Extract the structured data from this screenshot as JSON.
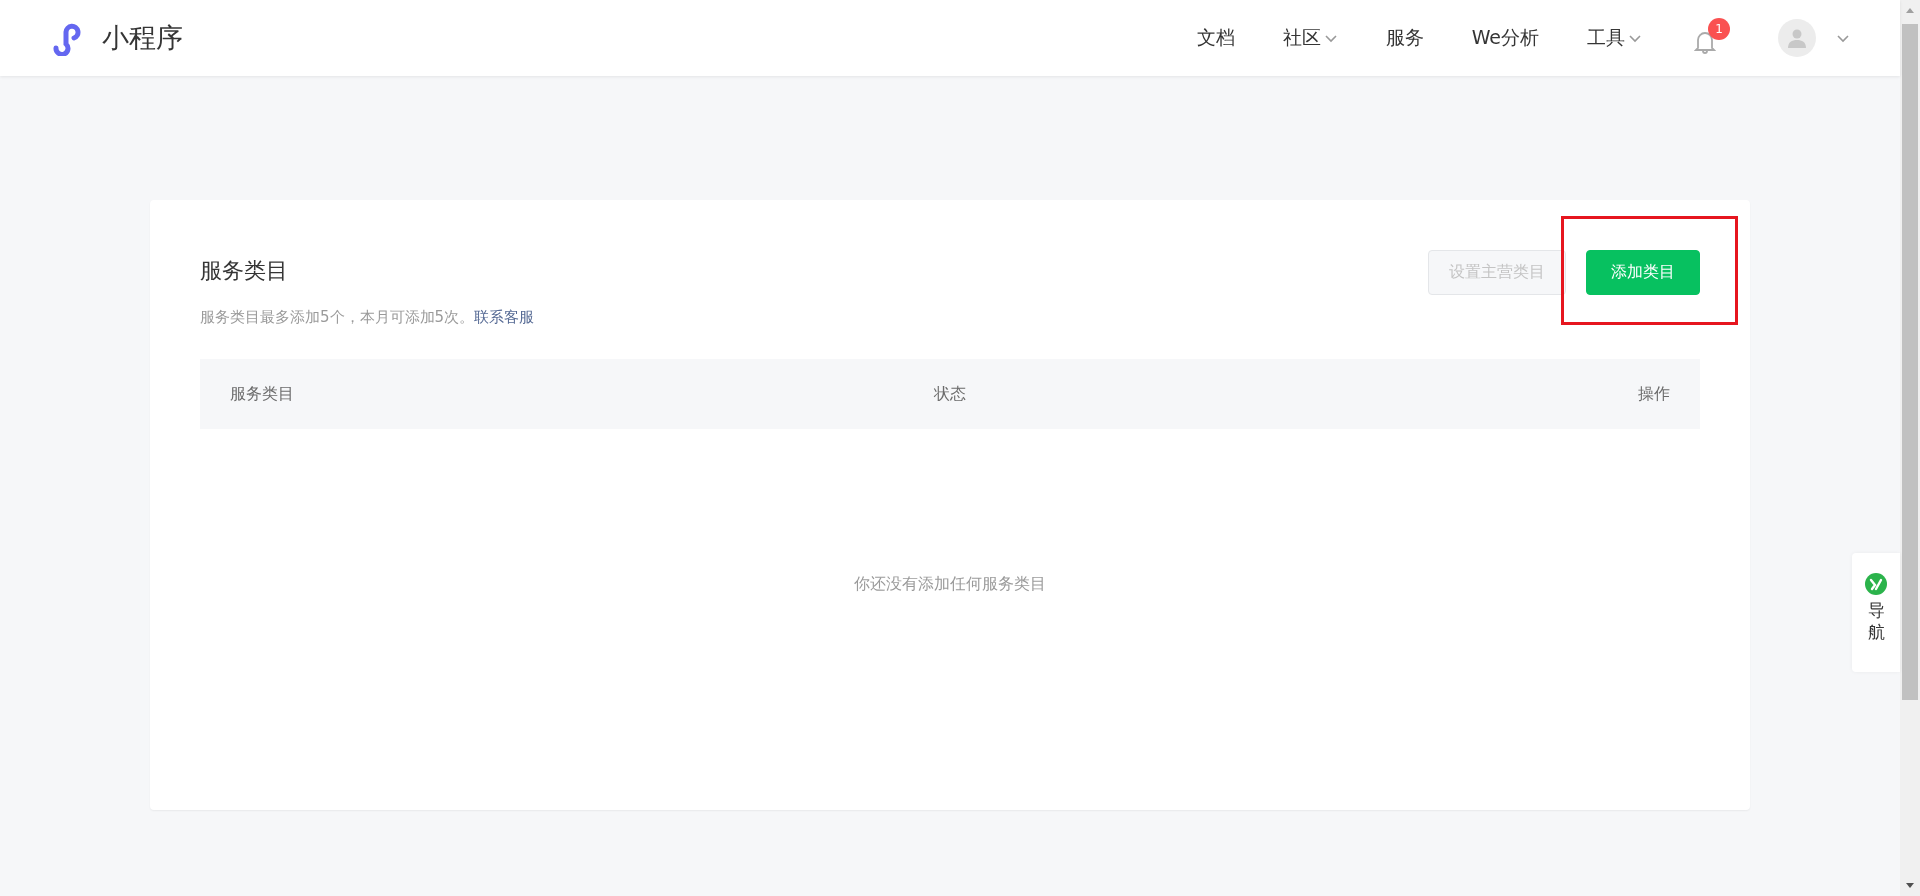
{
  "header": {
    "logo_text": "小程序",
    "nav": [
      {
        "label": "文档",
        "has_dropdown": false
      },
      {
        "label": "社区",
        "has_dropdown": true
      },
      {
        "label": "服务",
        "has_dropdown": false
      },
      {
        "label": "We分析",
        "has_dropdown": false
      },
      {
        "label": "工具",
        "has_dropdown": true
      }
    ],
    "notification_count": "1"
  },
  "card": {
    "title": "服务类目",
    "subtitle": "服务类目最多添加5个，本月可添加5次。",
    "subtitle_link": "联系客服",
    "buttons": [
      {
        "label": "设置主营类目",
        "disabled": true,
        "kind": "secondary"
      },
      {
        "label": "添加类目",
        "disabled": false,
        "kind": "primary",
        "highlighted": true
      }
    ],
    "table": {
      "columns": [
        "服务类目",
        "状态",
        "操作"
      ],
      "empty_text": "你还没有添加任何服务类目"
    }
  },
  "side_nav": {
    "label": "导航"
  }
}
